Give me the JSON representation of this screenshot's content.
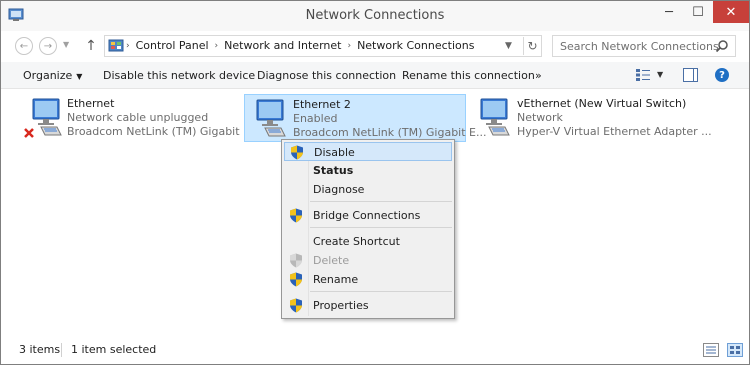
{
  "window": {
    "title": "Network Connections",
    "minimize_label": "─",
    "maximize_label": "☐",
    "close_label": "✕"
  },
  "address_bar": {
    "breadcrumbs": [
      "Control Panel",
      "Network and Internet",
      "Network Connections"
    ],
    "separator": "›",
    "search_placeholder": "Search Network Connections"
  },
  "command_bar": {
    "organize": "Organize",
    "disable": "Disable this network device",
    "diagnose": "Diagnose this connection",
    "rename": "Rename this connection",
    "more": "»"
  },
  "items": [
    {
      "name": "Ethernet",
      "status": "Network cable unplugged",
      "device": "Broadcom NetLink (TM) Gigabit E...",
      "icon": "network-adapter-disconnected-icon"
    },
    {
      "name": "Ethernet 2",
      "status": "Enabled",
      "device": "Broadcom NetLink (TM) Gigabit E...",
      "icon": "network-adapter-icon"
    },
    {
      "name": "vEthernet (New Virtual Switch)",
      "status": "Network",
      "device": "Hyper-V Virtual Ethernet Adapter ...",
      "icon": "network-adapter-icon"
    }
  ],
  "context_menu": {
    "disable": "Disable",
    "status": "Status",
    "diagnose": "Diagnose",
    "bridge": "Bridge Connections",
    "shortcut": "Create Shortcut",
    "delete": "Delete",
    "rename": "Rename",
    "properties": "Properties"
  },
  "status_bar": {
    "items_count": "3 items",
    "selected": "1 item selected"
  },
  "colors": {
    "selection_bg": "#cce8ff",
    "selection_border": "#99d1ff",
    "close_button": "#c7403a",
    "shield_blue": "#2a62b8",
    "shield_yellow": "#f2c21b"
  }
}
